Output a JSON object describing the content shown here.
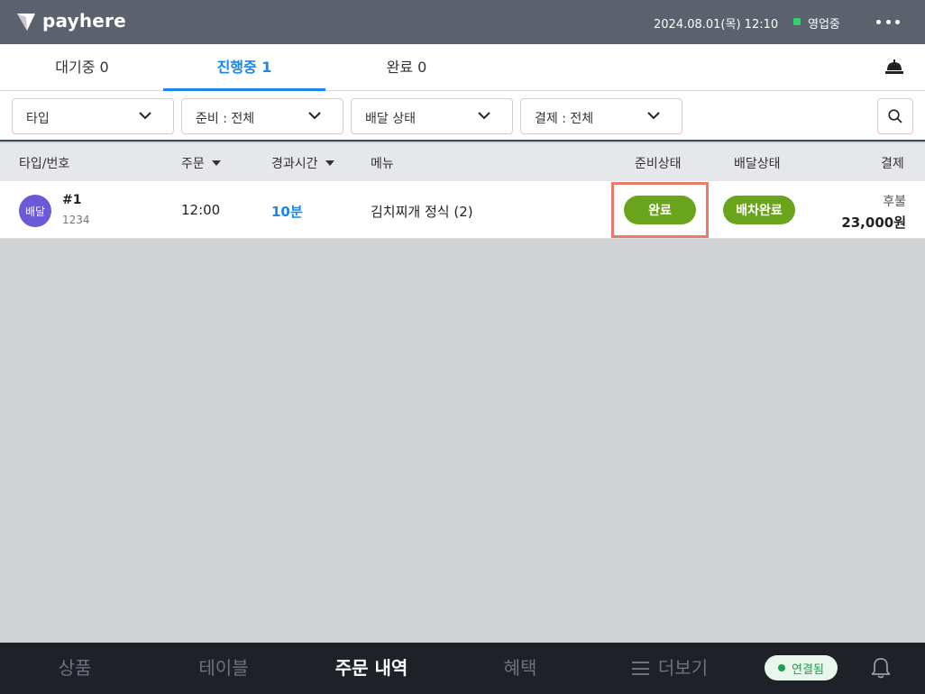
{
  "header": {
    "brand": "payhere",
    "datetime": "2024.08.01(목) 12:10",
    "status": "영업중",
    "status_color": "#2fd36a"
  },
  "tabs": [
    {
      "label": "대기중 0",
      "active": false
    },
    {
      "label": "진행중 1",
      "active": true
    },
    {
      "label": "완료 0",
      "active": false
    }
  ],
  "filters": [
    {
      "label": "타입"
    },
    {
      "label": "준비 : 전체"
    },
    {
      "label": "배달 상태"
    },
    {
      "label": "결제 : 전체"
    }
  ],
  "table": {
    "columns": [
      "타입/번호",
      "주문",
      "경과시간",
      "메뉴",
      "준비상태",
      "배달상태",
      "결제"
    ],
    "rows": [
      {
        "type": "배달",
        "number": "#1",
        "sub": "1234",
        "time": "12:00",
        "elapsed": "10분",
        "menu": "김치찌개 정식 (2)",
        "prep_status": "완료",
        "delivery_status": "배차완료",
        "payment_type": "후불",
        "amount": "23,000원"
      }
    ]
  },
  "bottom_nav": {
    "items": [
      "상품",
      "테이블",
      "주문 내역",
      "혜택",
      "더보기"
    ],
    "active": "주문 내역",
    "connection": "연결됨"
  },
  "colors": {
    "accent": "#1a86e6",
    "status_pill": "#6aa41d",
    "delivery_badge": "#6b5ad8",
    "highlight": "#ea7a6b"
  },
  "icons": [
    "payhere-logo-icon",
    "more-icon",
    "bell-service-icon",
    "chevron-down-icon",
    "search-icon",
    "menu-icon",
    "notification-bell-icon"
  ]
}
